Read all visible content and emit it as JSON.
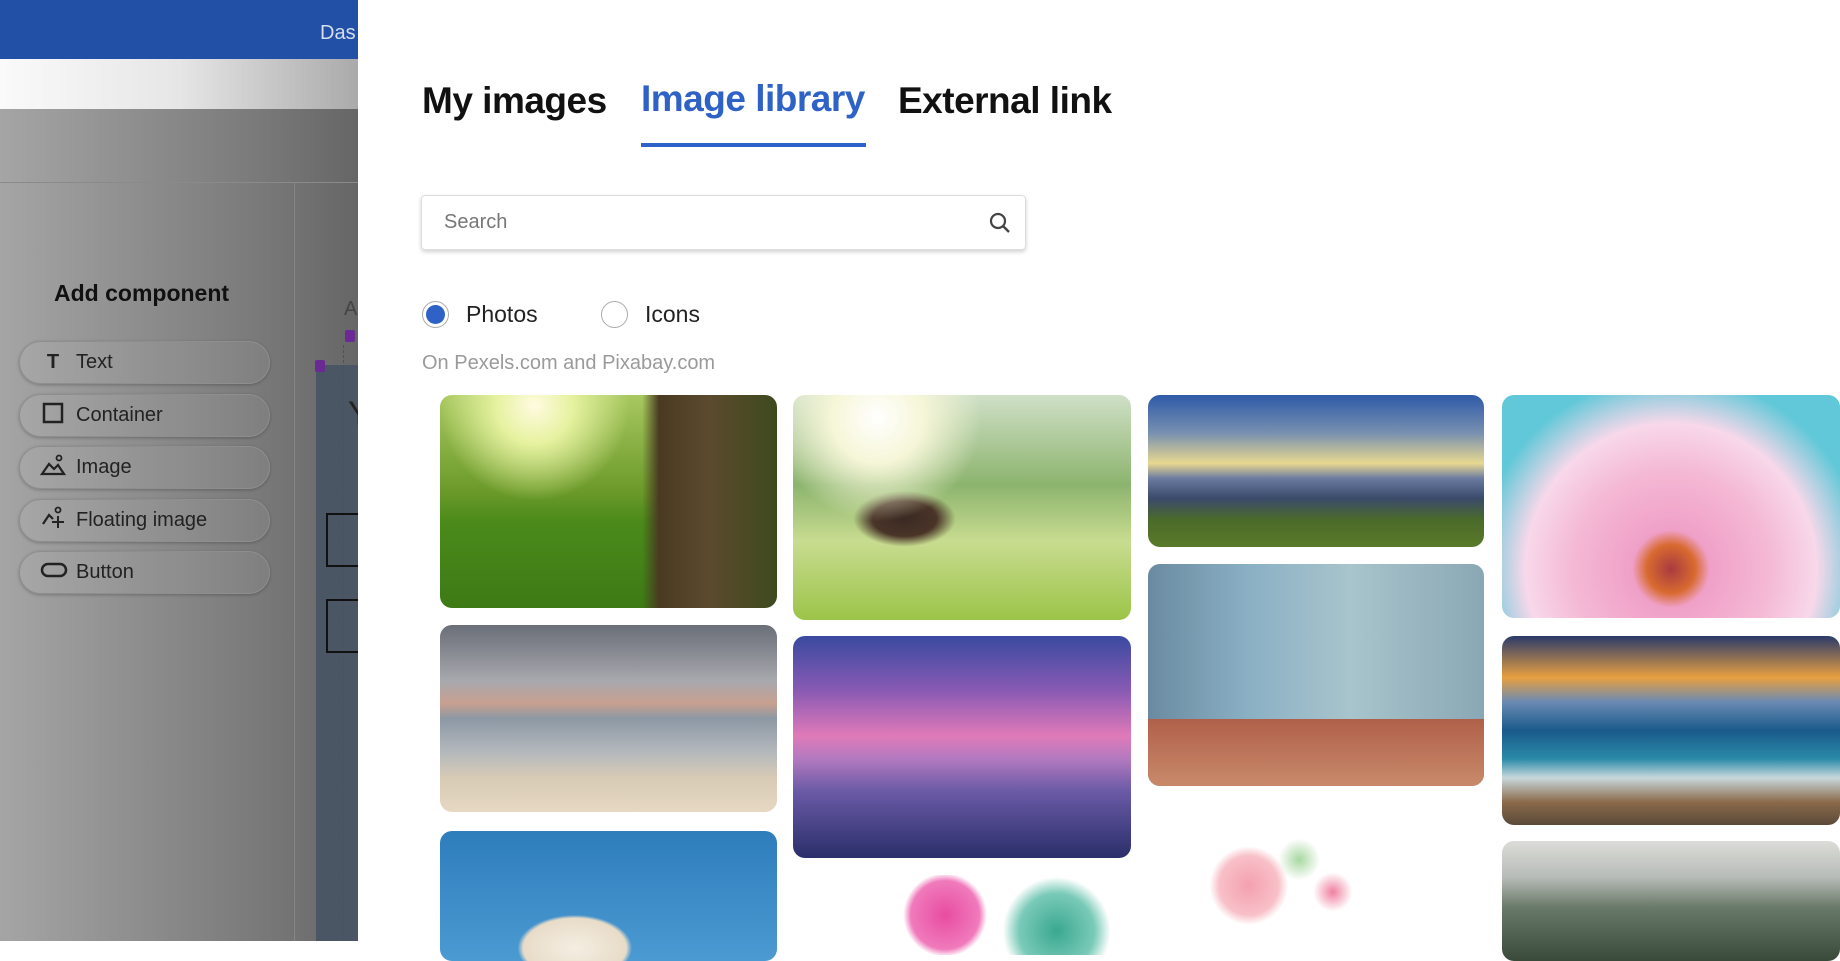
{
  "background": {
    "topbar_text": "Das",
    "sidebar": {
      "title": "Add component",
      "components": [
        {
          "label": "Text",
          "icon": "text-icon"
        },
        {
          "label": "Container",
          "icon": "square-icon"
        },
        {
          "label": "Image",
          "icon": "image-icon"
        },
        {
          "label": "Floating image",
          "icon": "floating-image-icon"
        },
        {
          "label": "Button",
          "icon": "button-shape-icon"
        }
      ]
    },
    "canvas_letter": "A",
    "canvas_letter2": "Y"
  },
  "dialog": {
    "tabs": [
      {
        "label": "My images",
        "active": false
      },
      {
        "label": "Image library",
        "active": true
      },
      {
        "label": "External link",
        "active": false
      }
    ],
    "search": {
      "placeholder": "Search",
      "value": "",
      "icon": "search-icon"
    },
    "filter": [
      {
        "label": "Photos",
        "selected": true
      },
      {
        "label": "Icons",
        "selected": false
      }
    ],
    "source_note": "On Pexels.com and Pixabay.com",
    "photos": [
      "sunlit-meadow-with-tree",
      "beach-with-palm-trees",
      "ice-cream-blue-sky",
      "woman-in-hat-in-field",
      "purple-sunset-boat",
      "pink-starfish",
      "mountain-sunrays",
      "blue-cafe-facade",
      "watercolor-flowers",
      "pink-daisy-closeup",
      "ocean-waves-sunset",
      "mountain-landscape"
    ],
    "accent_color": "#2f62c6"
  }
}
